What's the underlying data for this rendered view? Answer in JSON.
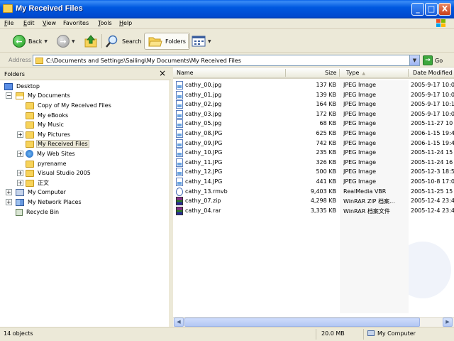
{
  "window": {
    "title": "My Received Files",
    "minimize_label": "_",
    "maximize_label": "□",
    "close_label": "X"
  },
  "menu": {
    "items": [
      {
        "key": "F",
        "rest": "ile"
      },
      {
        "key": "E",
        "rest": "dit"
      },
      {
        "key": "V",
        "rest": "iew"
      },
      {
        "key": "",
        "rest": "Favorites"
      },
      {
        "key": "T",
        "rest": "ools"
      },
      {
        "key": "H",
        "rest": "elp"
      }
    ]
  },
  "toolbar": {
    "back_label": "Back",
    "search_label": "Search",
    "folders_label": "Folders"
  },
  "address": {
    "label": "Address",
    "value": "C:\\Documents and Settings\\Sailing\\My Documents\\My Received Files",
    "go_label": "Go"
  },
  "folders_pane": {
    "title": "Folders",
    "close_label": "×",
    "tree": [
      {
        "label": "Desktop",
        "icon": "desktop-icon",
        "selected": false
      },
      {
        "label": "My Documents",
        "icon": "my-documents-icon",
        "selected": false
      },
      {
        "label": "Copy of My Received Files",
        "icon": "folder-icon",
        "selected": false
      },
      {
        "label": "My eBooks",
        "icon": "folder-icon",
        "selected": false
      },
      {
        "label": "My Music",
        "icon": "folder-icon",
        "selected": false
      },
      {
        "label": "My Pictures",
        "icon": "folder-icon",
        "selected": false
      },
      {
        "label": "My Received Files",
        "icon": "folder-open-icon",
        "selected": true
      },
      {
        "label": "My Web Sites",
        "icon": "globe-folder-icon",
        "selected": false
      },
      {
        "label": "pyrename",
        "icon": "folder-icon",
        "selected": false
      },
      {
        "label": "Visual Studio 2005",
        "icon": "folder-icon",
        "selected": false
      },
      {
        "label": "正文",
        "icon": "folder-icon",
        "selected": false
      },
      {
        "label": "My Computer",
        "icon": "computer-icon",
        "selected": false
      },
      {
        "label": "My Network Places",
        "icon": "network-icon",
        "selected": false
      },
      {
        "label": "Recycle Bin",
        "icon": "recycle-bin-icon",
        "selected": false
      }
    ]
  },
  "file_list": {
    "columns": {
      "name": "Name",
      "size": "Size",
      "type": "Type",
      "date": "Date Modified"
    },
    "sort_indicator": "▲",
    "rows": [
      {
        "name": "cathy_00.jpg",
        "size": "137 KB",
        "type": "JPEG Image",
        "date": "2005-9-17 10:0",
        "icon": "jpg"
      },
      {
        "name": "cathy_01.jpg",
        "size": "139 KB",
        "type": "JPEG Image",
        "date": "2005-9-17 10:0",
        "icon": "jpg"
      },
      {
        "name": "cathy_02.jpg",
        "size": "164 KB",
        "type": "JPEG Image",
        "date": "2005-9-17 10:1",
        "icon": "jpg"
      },
      {
        "name": "cathy_03.jpg",
        "size": "172 KB",
        "type": "JPEG Image",
        "date": "2005-9-17 10:0",
        "icon": "jpg"
      },
      {
        "name": "cathy_05.jpg",
        "size": "68 KB",
        "type": "JPEG Image",
        "date": "2005-11-27 10",
        "icon": "jpg"
      },
      {
        "name": "cathy_08.JPG",
        "size": "625 KB",
        "type": "JPEG Image",
        "date": "2006-1-15 19:4",
        "icon": "jpg"
      },
      {
        "name": "cathy_09.JPG",
        "size": "742 KB",
        "type": "JPEG Image",
        "date": "2006-1-15 19:4",
        "icon": "jpg"
      },
      {
        "name": "cathy_10.JPG",
        "size": "235 KB",
        "type": "JPEG Image",
        "date": "2005-11-24 15",
        "icon": "jpg"
      },
      {
        "name": "cathy_11.JPG",
        "size": "326 KB",
        "type": "JPEG Image",
        "date": "2005-11-24 16",
        "icon": "jpg"
      },
      {
        "name": "cathy_12.JPG",
        "size": "500 KB",
        "type": "JPEG Image",
        "date": "2005-12-3 18:5",
        "icon": "jpg"
      },
      {
        "name": "cathy_14.JPG",
        "size": "441 KB",
        "type": "JPEG Image",
        "date": "2005-10-8 17:0",
        "icon": "jpg"
      },
      {
        "name": "cathy_13.rmvb",
        "size": "9,403 KB",
        "type": "RealMedia VBR",
        "date": "2005-11-25 15",
        "icon": "rmvb"
      },
      {
        "name": "cathy_07.zip",
        "size": "4,298 KB",
        "type": "WinRAR ZIP 档案...",
        "date": "2005-12-4 23:4",
        "icon": "rar"
      },
      {
        "name": "cathy_04.rar",
        "size": "3,335 KB",
        "type": "WinRAR 档案文件",
        "date": "2005-12-4 23:4",
        "icon": "rar"
      }
    ]
  },
  "statusbar": {
    "count": "14 objects",
    "size": "20.0 MB",
    "location": "My Computer"
  }
}
